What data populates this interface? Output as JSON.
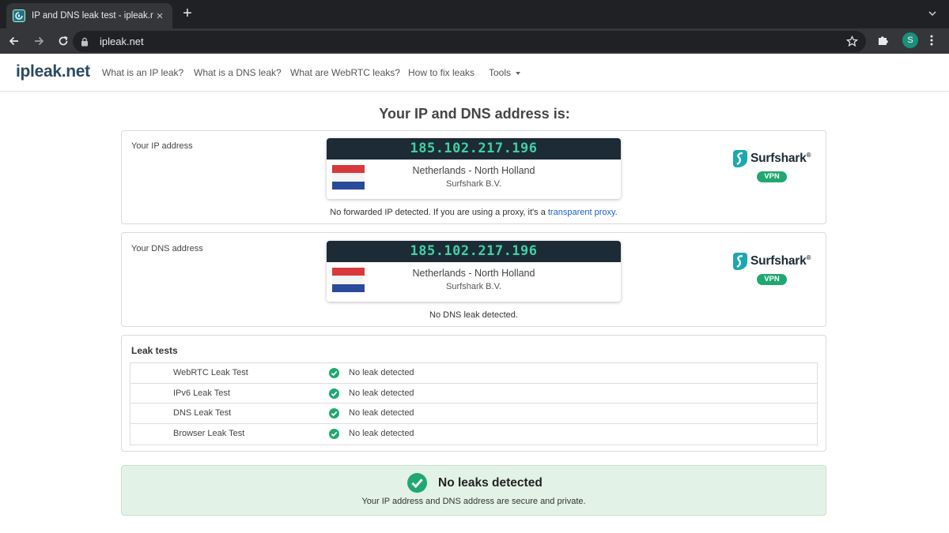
{
  "browser": {
    "tab_title": "IP and DNS leak test - ipleak.net",
    "url": "ipleak.net",
    "avatar_letter": "S"
  },
  "site": {
    "logo": "ipleak.net",
    "nav": [
      {
        "label": "What is an IP leak?"
      },
      {
        "label": "What is a DNS leak?"
      },
      {
        "label": "What are WebRTC leaks?"
      },
      {
        "label": "How to fix leaks"
      },
      {
        "label": "Tools"
      }
    ]
  },
  "heading": "Your IP and DNS address is:",
  "ip_card": {
    "label": "Your IP address",
    "ip": "185.102.217.196",
    "location": "Netherlands - North Holland",
    "isp": "Surfshark B.V.",
    "brand": "Surfshark",
    "brand_mark": "®",
    "badge": "VPN",
    "note_text": "No forwarded IP detected. If you are using a proxy, it's a ",
    "note_link": "transparent proxy",
    "note_end": "."
  },
  "dns_card": {
    "label": "Your DNS address",
    "ip": "185.102.217.196",
    "location": "Netherlands - North Holland",
    "isp": "Surfshark B.V.",
    "brand": "Surfshark",
    "brand_mark": "®",
    "badge": "VPN",
    "note_text": "No DNS leak detected."
  },
  "leak_tests": {
    "title": "Leak tests",
    "rows": [
      {
        "name": "WebRTC Leak Test",
        "status": "No leak detected"
      },
      {
        "name": "IPv6 Leak Test",
        "status": "No leak detected"
      },
      {
        "name": "DNS Leak Test",
        "status": "No leak detected"
      },
      {
        "name": "Browser Leak Test",
        "status": "No leak detected"
      }
    ]
  },
  "summary": {
    "title": "No leaks detected",
    "subtitle": "Your IP address and DNS address are secure and private."
  },
  "colors": {
    "accent_green": "#1fa870",
    "ip_text": "#3fd1a4",
    "ip_header_bg": "#1c2b35",
    "success_bg": "#e3f2e6",
    "link": "#1a5fc7"
  }
}
